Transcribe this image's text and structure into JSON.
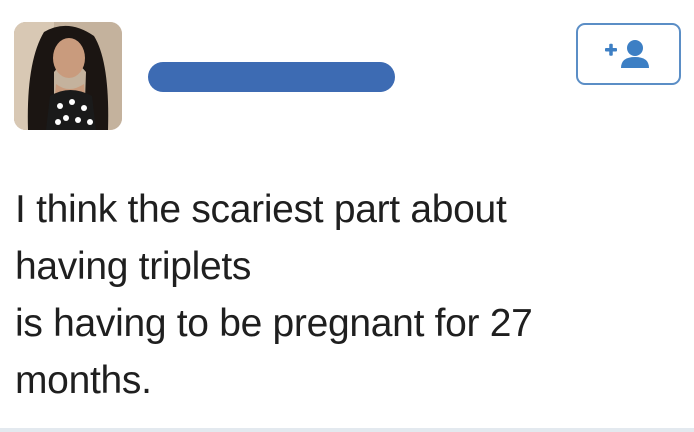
{
  "tweet": {
    "text_lines": [
      "I think the scariest part about",
      "having triplets",
      "is having to be pregnant for 27",
      "months."
    ]
  },
  "colors": {
    "name_redaction": "#3d6bb3",
    "follow_border": "#5b8ec6",
    "follow_icon": "#3d7fc4",
    "text": "#1f1f1f"
  },
  "icons": {
    "follow": "add-user-icon"
  }
}
